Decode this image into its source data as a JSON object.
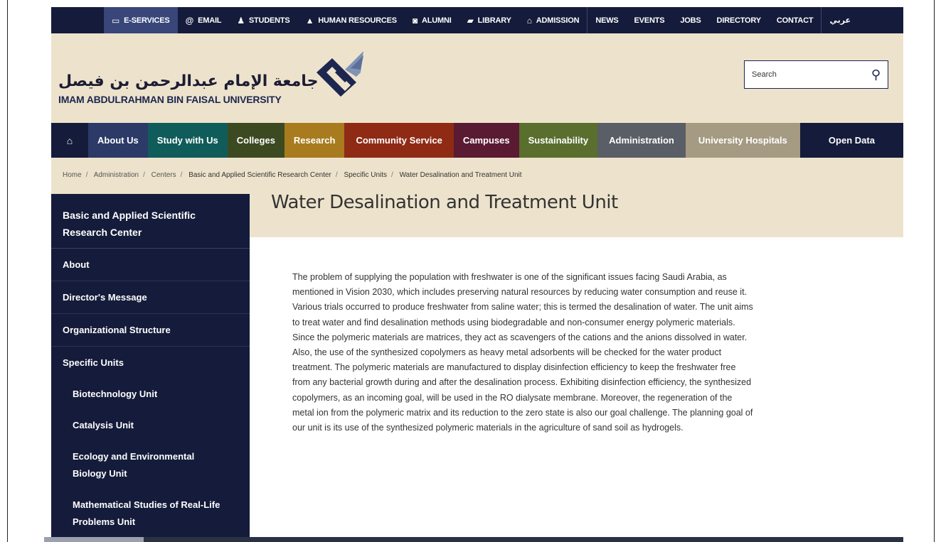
{
  "topbar": {
    "items": [
      {
        "label": "E-SERVICES",
        "icon": "laptop-icon",
        "active": true
      },
      {
        "label": "EMAIL",
        "icon": "at-icon"
      },
      {
        "label": "STUDENTS",
        "icon": "user-icon"
      },
      {
        "label": "HUMAN RESOURCES",
        "icon": "graduation-cap-icon"
      },
      {
        "label": "ALUMNI",
        "icon": "camera-icon"
      },
      {
        "label": "LIBRARY",
        "icon": "book-icon"
      },
      {
        "label": "ADMISSION",
        "icon": "institution-icon"
      },
      {
        "label": "NEWS"
      },
      {
        "label": "EVENTS"
      },
      {
        "label": "JOBS"
      },
      {
        "label": "DIRECTORY"
      },
      {
        "label": "CONTACT"
      },
      {
        "label": "عربي"
      }
    ]
  },
  "header": {
    "logo_arabic": "جامعة الإمام عبدالرحمن بن فيصل",
    "logo_english": "IMAM ABDULRAHMAN BIN FAISAL UNIVERSITY",
    "search_placeholder": "Search"
  },
  "mainnav": {
    "items": [
      {
        "label": "",
        "icon": "home-icon",
        "color": "#151b3a"
      },
      {
        "label": "About Us",
        "color": "#2b3a66"
      },
      {
        "label": "Study with Us",
        "color": "#0f5c5a"
      },
      {
        "label": "Colleges",
        "color": "#3c4a22"
      },
      {
        "label": "Research",
        "color": "#a87c1e"
      },
      {
        "label": "Community Service",
        "color": "#8f2a15"
      },
      {
        "label": "Campuses",
        "color": "#5a1a32"
      },
      {
        "label": "Sustainability",
        "color": "#5a6e2e"
      },
      {
        "label": "Administration",
        "color": "#5a5e66",
        "active": true
      },
      {
        "label": "University Hospitals",
        "color": "#a59a82"
      },
      {
        "label": "Open Data",
        "color": "#151b3a"
      }
    ]
  },
  "breadcrumb": [
    "Home",
    "Administration",
    "Centers",
    "Basic and Applied Scientific Research Center",
    "Specific Units",
    "Water Desalination and Treatment Unit"
  ],
  "page": {
    "title": "Water Desalination and Treatment Unit",
    "body": "The problem of supplying the population with freshwater is one of the significant issues facing Saudi Arabia, as mentioned in Vision 2030, which includes preserving natural resources by reducing water consumption and reuse it. Various trials occurred to produce freshwater from saline water; this is termed the desalination of water. The unit aims to treat water and find desalination methods using biodegradable and non-consumer energy polymeric materials.  Since the polymeric materials are matrices, they act as scavengers of the cations and the anions dissolved in water. Also, the use of the synthesized copolymers as heavy metal adsorbents will be checked for the water product treatment. The polymeric materials are manufactured to display disinfection efficiency to keep the freshwater free from any bacterial growth during and after the desalination process. Exhibiting disinfection efficiency, the synthesized copolymers, as an incoming goal, will be used in the RO dialysate membrane. Moreover, the regeneration of the metal ion from the polymeric matrix and its reduction to the zero state is also our goal challenge. The planning goal of our unit is its use of the synthesized polymeric materials in the agriculture of sand soil as hydrogels."
  },
  "sidebar": {
    "heading": "Basic and Applied Scientific Research Center",
    "items": [
      "About",
      "Director's Message",
      "Organizational Structure",
      "Specific Units"
    ],
    "sub_items": [
      "Biotechnology Unit",
      "Catalysis Unit",
      "Ecology and Environmental Biology Unit",
      "Mathematical Studies of Real-Life Problems Unit"
    ]
  }
}
